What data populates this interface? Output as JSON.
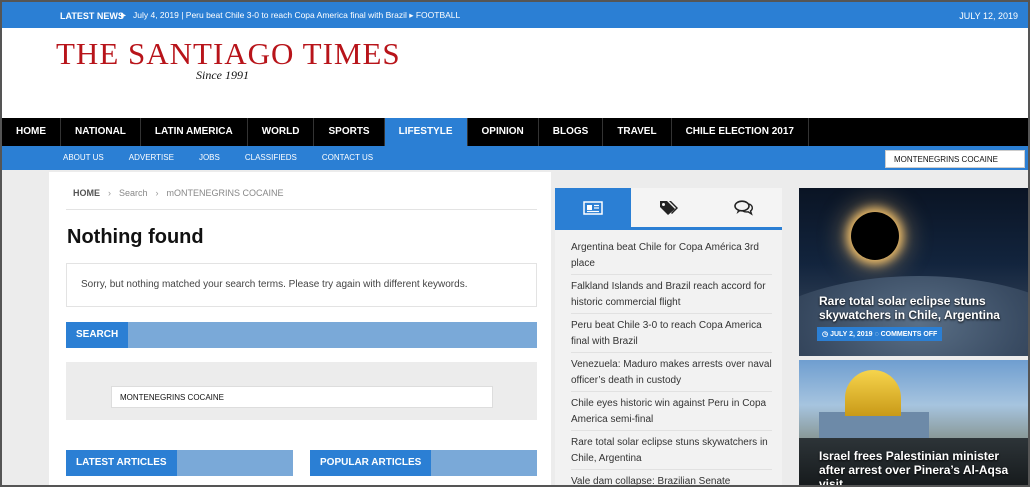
{
  "topbar": {
    "latest_label": "LATEST NEWS",
    "ticker": "July 4, 2019  |  Peru beat Chile 3-0 to reach Copa America final with Brazil  ▸  FOOTBALL",
    "date": "JULY 12, 2019"
  },
  "header": {
    "logo_text": "THE SANTIAGO TIMES",
    "tagline": "Since 1991"
  },
  "main_nav": {
    "items": [
      "HOME",
      "NATIONAL",
      "LATIN AMERICA",
      "WORLD",
      "SPORTS",
      "LIFESTYLE",
      "OPINION",
      "BLOGS",
      "TRAVEL",
      "CHILE ELECTION 2017"
    ],
    "active": "LIFESTYLE"
  },
  "sub_nav": {
    "items": [
      "ABOUT US",
      "ADVERTISE",
      "JOBS",
      "CLASSIFIEDS",
      "CONTACT US"
    ],
    "search_value": "MONTENEGRINS COCAINE"
  },
  "breadcrumb": {
    "home": "HOME",
    "search": "Search",
    "query": "mONTENEGRINS COCAINE"
  },
  "results": {
    "title": "Nothing found",
    "message": "Sorry, but nothing matched your search terms. Please try again with different keywords."
  },
  "search_widget": {
    "heading": "SEARCH",
    "value": "MONTENEGRINS COCAINE"
  },
  "bottom_tabs": {
    "latest": "LATEST ARTICLES",
    "popular": "POPULAR ARTICLES"
  },
  "sidebar_tabs": {
    "icons": [
      "newspaper-icon",
      "tags-icon",
      "comments-icon"
    ]
  },
  "news_list": [
    "Argentina beat Chile for Copa América 3rd place",
    "Falkland Islands and Brazil reach accord for historic commercial flight",
    "Peru beat Chile 3-0 to reach Copa America final with Brazil",
    "Venezuela: Maduro makes arrests over naval officer’s death in custody",
    "Chile eyes historic win against Peru in Copa America semi-final",
    "Rare total solar eclipse stuns skywatchers in Chile, Argentina",
    "Vale dam collapse: Brazilian Senate"
  ],
  "featured": [
    {
      "title": "Rare total solar eclipse stuns skywatchers in Chile, Argentina",
      "date": "JULY 2, 2019",
      "comments": "COMMENTS OFF"
    },
    {
      "title": "Israel frees Palestinian minister after arrest over Pinera’s Al-Aqsa visit"
    }
  ],
  "colors": {
    "brand_blue": "#2b7fd4",
    "logo_red": "#b8141a"
  }
}
